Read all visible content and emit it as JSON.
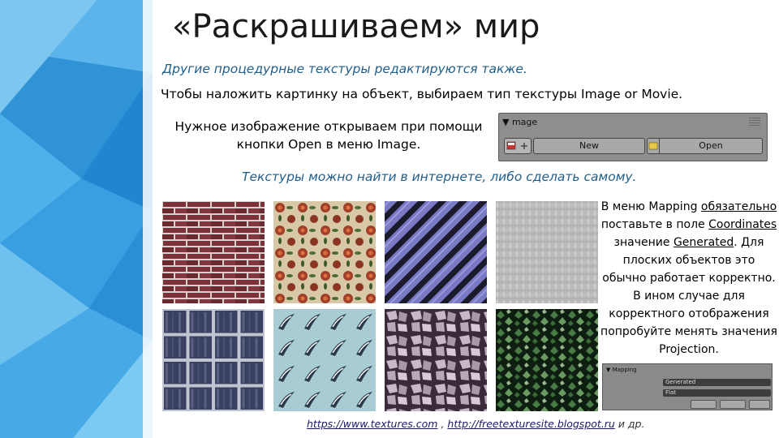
{
  "slide": {
    "title": "«Раскрашиваем» мир",
    "subtitle_italic": "Другие процедурные текстуры редактируются также.",
    "line_image_type": "Чтобы наложить картинку на объект, выбираем тип текстуры Image or Movie.",
    "line_open": "Нужное изображение открываем при помощи кнопки Open в меню Image.",
    "line_textures_source": "Текстуры можно найти в интернете, либо сделать самому.",
    "mapping_text": {
      "p1": "В меню Mapping ",
      "u1": "обязательно",
      "p2": " поставьте в поле ",
      "u2": "Coordinates",
      "p3": " значение ",
      "u3": "Generated",
      "p4": ". Для плоских объектов это обычно работает корректно. В ином случае для корректного отображения попробуйте менять значения Projection."
    },
    "links": {
      "link1": "https://www.textures.com",
      "sep": " , ",
      "link2": "http://freetexturesite.blogspot.ru",
      "suffix": " и др."
    }
  },
  "image_panel": {
    "header": "▼ mage",
    "new_label": "New",
    "open_label": "Open"
  },
  "mapping_panel": {
    "header": "▼ Mapping",
    "coordinates_value": "Generated",
    "projection_value": "Flat"
  },
  "textures": [
    "brick-texture",
    "floral-texture",
    "diagonal-stripes-texture",
    "knit-texture",
    "metal-tiles-texture",
    "dolphin-pattern-texture",
    "stone-texture",
    "ivy-texture"
  ],
  "colors": {
    "accent_blue": "#1f5d8a",
    "sidebar_blue": "#3aa0e0"
  }
}
